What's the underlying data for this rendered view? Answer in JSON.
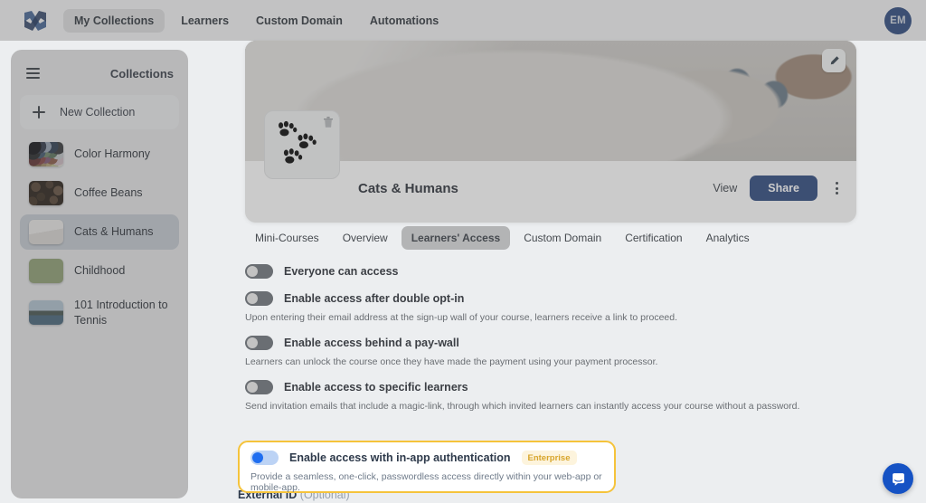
{
  "topnav": {
    "logo_icon": "brand-logo-icon",
    "items": [
      {
        "label": "My Collections",
        "active": true
      },
      {
        "label": "Learners",
        "active": false
      },
      {
        "label": "Custom Domain",
        "active": false
      },
      {
        "label": "Automations",
        "active": false
      }
    ],
    "avatar_initials": "EM"
  },
  "sidebar": {
    "menu_icon": "hamburger-icon",
    "title": "Collections",
    "new_collection_label": "New Collection",
    "items": [
      {
        "label": "Color Harmony",
        "selected": false,
        "thumb": "color-swatches"
      },
      {
        "label": "Coffee Beans",
        "selected": false,
        "thumb": "coffee-beans"
      },
      {
        "label": "Cats & Humans",
        "selected": true,
        "thumb": "cat-photo"
      },
      {
        "label": "Childhood",
        "selected": false,
        "thumb": "field-photo"
      },
      {
        "label": "101 Introduction to Tennis",
        "selected": false,
        "thumb": "tennis-court"
      }
    ]
  },
  "collection": {
    "hero_image_alt": "kitten-lying-on-blanket",
    "edit_icon": "pencil-icon",
    "logo_icon": "paw-prints-icon",
    "delete_icon": "trash-icon",
    "title": "Cats & Humans",
    "view_label": "View",
    "share_label": "Share",
    "more_icon": "kebab-menu-icon"
  },
  "tabs": [
    {
      "label": "Mini-Courses",
      "active": false
    },
    {
      "label": "Overview",
      "active": false
    },
    {
      "label": "Learners' Access",
      "active": true
    },
    {
      "label": "Custom Domain",
      "active": false
    },
    {
      "label": "Certification",
      "active": false
    },
    {
      "label": "Analytics",
      "active": false
    }
  ],
  "settings": [
    {
      "label": "Everyone can access",
      "description": "",
      "enabled": false
    },
    {
      "label": "Enable access after double opt-in",
      "description": "Upon entering their email address at the sign-up wall of your course, learners receive a link to proceed.",
      "enabled": false
    },
    {
      "label": "Enable access behind a pay-wall",
      "description": "Learners can unlock the course once they have made the payment using your payment processor.",
      "enabled": false
    },
    {
      "label": "Enable access to specific learners",
      "description": "Send invitation emails that include a magic-link, through which invited learners can instantly access your course without a password.",
      "enabled": false
    }
  ],
  "highlighted_setting": {
    "label": "Enable access with in-app authentication",
    "badge": "Enterprise",
    "description": "Provide a seamless, one-click, passwordless access directly within your web-app or mobile-app.",
    "enabled": true,
    "border_color": "#f5c33b"
  },
  "external_id": {
    "label": "External ID",
    "optional_label": "(Optional)"
  },
  "chat_widget": {
    "icon": "chat-bubble-icon",
    "color": "#1552c4"
  },
  "colors": {
    "accent": "#1552c4",
    "toggle_on": "#1f6ef0",
    "highlight": "#f5c33b",
    "badge_text": "#d8a52b"
  }
}
